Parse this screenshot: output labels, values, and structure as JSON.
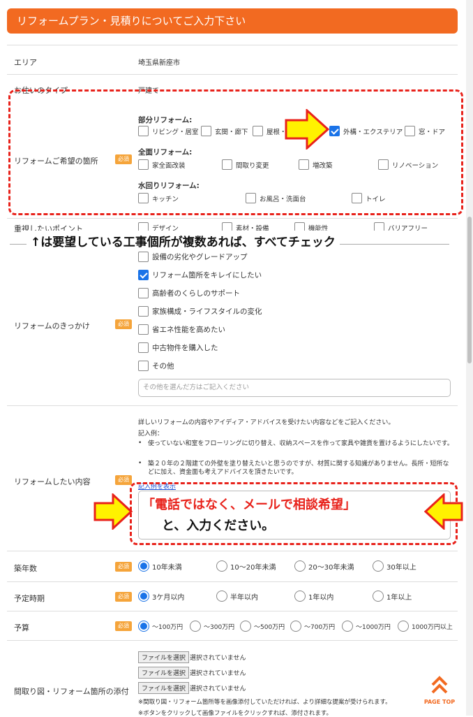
{
  "header": {
    "title": "リフォームプラン・見積りについてご入力下さい"
  },
  "area": {
    "label": "エリア",
    "value": "埼玉県新座市"
  },
  "house": {
    "label": "お住いのタイプ",
    "value": "戸建て"
  },
  "location": {
    "label": "リフォームご希望の箇所",
    "required": "必須",
    "partial": {
      "title": "部分リフォーム:",
      "items": [
        "リビング・居室",
        "玄関・廊下",
        "屋根・",
        "外構・エクステリア",
        "窓・ドア"
      ]
    },
    "full": {
      "title": "全面リフォーム:",
      "items": [
        "家全面改装",
        "間取り変更",
        "増改築",
        "リノベーション"
      ]
    },
    "water": {
      "title": "水回りリフォーム:",
      "items": [
        "キッチン",
        "お風呂・洗面台",
        "トイレ"
      ]
    }
  },
  "priority": {
    "label": "重視したいポイント",
    "items": [
      "デザイン",
      "素材・設備",
      "機能性",
      "バリアフリー"
    ]
  },
  "annotation1": "↑は要望している工事個所が複数あれば、すべてチェック",
  "trigger": {
    "label": "リフォームのきっかけ",
    "required": "必須",
    "items": [
      "設備の劣化やグレードアップ",
      "リフォーム箇所をキレイにしたい",
      "高齢者のくらしのサポート",
      "家族構成・ライフスタイルの変化",
      "省エネ性能を高めたい",
      "中古物件を購入した",
      "その他"
    ],
    "other_placeholder": "その他を選んだ方はご記入ください"
  },
  "content": {
    "label": "リフォームしたい内容",
    "required": "必須",
    "intro": "詳しいリフォームの内容やアイディア・アドバイスを受けたい内容などをご記入ください。",
    "example_title": "記入例：",
    "example1": "使っていない和室をフローリングに切り替え、収納スペースを作って家具や雑貨を置けるようにしたいです。",
    "example2": "築２０年の２階建ての外壁を塗り替えたいと思うのですが、材質に関する知識がありません。長所・短所などに加え、資金面も考えアドバイスを頂きたいです。",
    "link": "記入例を表示",
    "callout1": "「電話ではなく、メールで相談希望」",
    "callout2": "と、入力ください。"
  },
  "age": {
    "label": "築年数",
    "required": "必須",
    "options": [
      "10年未満",
      "10～20年未満",
      "20～30年未満",
      "30年以上"
    ]
  },
  "timing": {
    "label": "予定時期",
    "required": "必須",
    "options": [
      "3ケ月以内",
      "半年以内",
      "1年以内",
      "1年以上"
    ]
  },
  "budget": {
    "label": "予算",
    "required": "必須",
    "options": [
      "～100万円",
      "～300万円",
      "～500万円",
      "～700万円",
      "～1000万円",
      "1000万円以上"
    ]
  },
  "attach": {
    "label": "間取り図・リフォーム箇所の添付",
    "button": "ファイルを選択",
    "status": "選択されていません",
    "note": "※間取り図・リフォーム箇所等を画像添付していただければ、より詳細な提案が受けられます。",
    "note2": "※ボタンをクリックして画像ファイルをクリックすれば、添付されます。"
  },
  "pagetop": "PAGE TOP"
}
